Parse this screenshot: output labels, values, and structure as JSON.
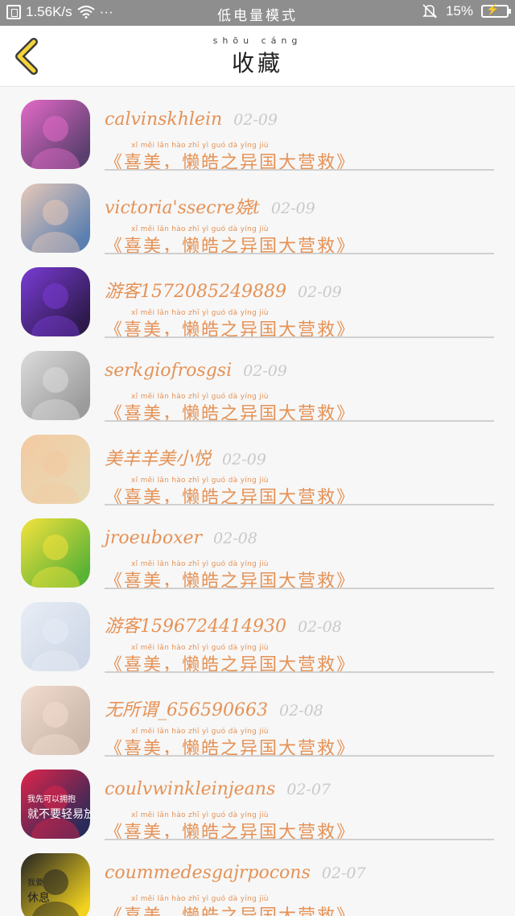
{
  "status_bar": {
    "speed": "1.56K/s",
    "dots": "···",
    "mode": "低电量模式",
    "battery": "15%"
  },
  "header": {
    "title_pinyin": "shōu cáng",
    "title": "收藏"
  },
  "items": [
    {
      "name": "calvinskhlein",
      "date": "02-09",
      "message": "《喜美，懒皓之异国大营救》",
      "avatar": {
        "bg": "#5a3f6e",
        "accent": "#e46ac8"
      }
    },
    {
      "name": "victoria'ssecre娆t",
      "date": "02-09",
      "message": "《喜美，懒皓之异国大营救》",
      "avatar": {
        "bg": "#5b7fb0",
        "accent": "#e8c9b8"
      }
    },
    {
      "name": "游客15720852​49889",
      "date": "02-09",
      "message": "《喜美，懒皓之异国大营救》",
      "avatar": {
        "bg": "#2d1a4a",
        "accent": "#7a3bd6"
      }
    },
    {
      "name": "serkgiofrosgsi",
      "date": "02-09",
      "message": "《喜美，懒皓之异国大营救》",
      "avatar": {
        "bg": "#9b9b9b",
        "accent": "#dcdcdc"
      }
    },
    {
      "name": "美羊羊美小悦",
      "date": "02-09",
      "message": "《喜美，懒皓之异国大营救》",
      "avatar": {
        "bg": "#e8d9b5",
        "accent": "#f3c9a0"
      }
    },
    {
      "name": "jroeuboxer",
      "date": "02-08",
      "message": "《喜美，懒皓之异国大营救》",
      "avatar": {
        "bg": "#5bb336",
        "accent": "#f5e23c"
      }
    },
    {
      "name": "游客1596724414930",
      "date": "02-08",
      "message": "《喜美，懒皓之异国大营救》",
      "avatar": {
        "bg": "#cfd8e8",
        "accent": "#e8edf5"
      }
    },
    {
      "name": "无所谓_656590663",
      "date": "02-08",
      "message": "《喜美，懒皓之异国大营救》",
      "avatar": {
        "bg": "#c9b6a8",
        "accent": "#f2dcd0"
      }
    },
    {
      "name": "coulvwinkleinjeans",
      "date": "02-07",
      "message": "《喜美，懒皓之异国大营救》",
      "avatar": {
        "bg": "#2a2a5a",
        "accent": "#e0244a",
        "caption1": "我先可以拥抱",
        "caption2": "就不要轻易放掉"
      }
    },
    {
      "name": "coummedesgajrpocons",
      "date": "02-07",
      "message": "《喜美，懒皓之异国大营救》",
      "avatar": {
        "bg": "#f2d21f",
        "accent": "#222222",
        "caption1": "我要",
        "caption2": "休息"
      }
    }
  ],
  "msg_pinyin": "xǐ   měi        lǎn   hào   zhī   yì   guó   dà   yíng  jiù"
}
